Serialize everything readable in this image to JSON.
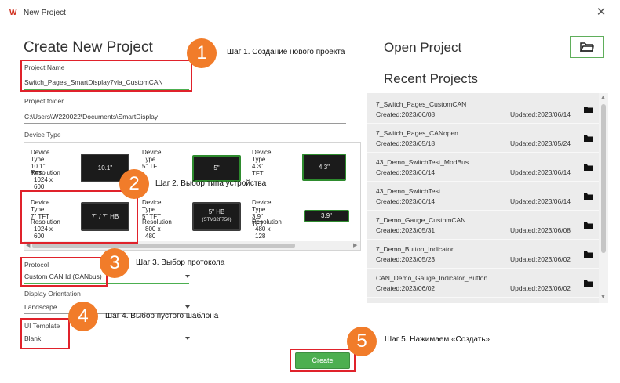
{
  "window": {
    "title": "New Project",
    "logo_text": "W"
  },
  "create": {
    "heading": "Create New Project",
    "project_name": {
      "label": "Project Name",
      "value": "Switch_Pages_SmartDisplay7via_CustomCAN"
    },
    "project_folder": {
      "label": "Project folder",
      "value": "C:\\Users\\W220022\\Documents\\SmartDisplay"
    },
    "device_type_label": "Device Type",
    "devices": [
      {
        "type_label": "Device Type",
        "type_value": "10.1\" TFT",
        "res_label": "Resolution",
        "res_value": "1024 x 600",
        "screen": "10.1\""
      },
      {
        "type_label": "Device Type",
        "type_value": "5\" TFT",
        "res_label": "",
        "res_value": "",
        "screen": "5\""
      },
      {
        "type_label": "Device Type",
        "type_value": "4.3\" TFT",
        "res_label": "",
        "res_value": "",
        "screen": "4.3\""
      },
      {
        "type_label": "Device Type",
        "type_value": "7\" TFT",
        "res_label": "Resolution",
        "res_value": "1024 x 600",
        "screen": "7\" / 7\" HB"
      },
      {
        "type_label": "Device Type",
        "type_value": "5\" TFT",
        "res_label": "Resolution",
        "res_value": "800 x 480",
        "screen": "5\" HB",
        "screen_sub": "(STM32F750)"
      },
      {
        "type_label": "Device Type",
        "type_value": "3.9\" TFT",
        "res_label": "Resolution",
        "res_value": "480 x 128",
        "screen": "3.9\""
      }
    ],
    "protocol": {
      "label": "Protocol",
      "value": "Custom CAN Id (CANbus)"
    },
    "orientation": {
      "label": "Display Orientation",
      "value": "Landscape"
    },
    "template": {
      "label": "UI Template",
      "value": "Blank"
    },
    "create_label": "Create"
  },
  "open": {
    "heading": "Open Project"
  },
  "recent": {
    "heading": "Recent Projects",
    "items": [
      {
        "name": "7_Switch_Pages_CustomCAN",
        "created": "Created:2023/06/08",
        "updated": "Updated:2023/06/14"
      },
      {
        "name": "7_Switch_Pages_CANopen",
        "created": "Created:2023/05/18",
        "updated": "Updated:2023/05/24"
      },
      {
        "name": "43_Demo_SwitchTest_ModBus",
        "created": "Created:2023/06/14",
        "updated": "Updated:2023/06/14"
      },
      {
        "name": "43_Demo_SwitchTest",
        "created": "Created:2023/06/14",
        "updated": "Updated:2023/06/14"
      },
      {
        "name": "7_Demo_Gauge_CustomCAN",
        "created": "Created:2023/05/31",
        "updated": "Updated:2023/06/08"
      },
      {
        "name": "7_Demo_Button_Indicator",
        "created": "Created:2023/05/23",
        "updated": "Updated:2023/06/02"
      },
      {
        "name": "CAN_Demo_Gauge_Indicator_Button",
        "created": "Created:2023/06/02",
        "updated": "Updated:2023/06/02"
      }
    ]
  },
  "steps": [
    {
      "num": "1",
      "text": "Шаг 1. Создание нового проекта"
    },
    {
      "num": "2",
      "text": "Шаг 2. Выбор типа устройства"
    },
    {
      "num": "3",
      "text": "Шаг 3. Выбор протокола"
    },
    {
      "num": "4",
      "text": "Шаг 4. Выбор пустого шаблона"
    },
    {
      "num": "5",
      "text": "Шаг 5. Нажимаем «Создать»"
    }
  ],
  "colors": {
    "accent": "#4caf50",
    "highlight": "#e0222b",
    "step_badge": "#f17c2a"
  }
}
